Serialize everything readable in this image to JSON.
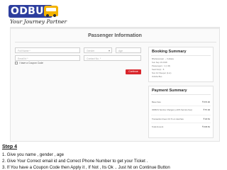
{
  "logo": {
    "brand": "ODBUS",
    "tagline": "Your Journey Partner"
  },
  "page": {
    "title": "Passenger Information"
  },
  "form": {
    "full_name_placeholder": "Full Name *",
    "gender_value": "Gender",
    "age_placeholder": "Age",
    "email_placeholder": "Email Id *",
    "phone_placeholder": "Contact No. *",
    "coupon_label": "I have a Coupon Code",
    "continue_label": "Continue"
  },
  "booking_summary": {
    "title": "Booking Summary",
    "lines": [
      "Bhubaneswar → Kolkata",
      "Sun Sep 16 2018",
      "Passengers : 1 (1 M)",
      "Seat No(s) : 8",
      "Non AC Sleeper (2+1)",
      "Odisha Bus"
    ]
  },
  "payment_summary": {
    "title": "Payment Summary",
    "rows": [
      {
        "label": "Base Fare",
        "value": "₹ 570.00"
      },
      {
        "label": "ODBUS Service Charges (+10% Service Fee)",
        "value": "₹ 57.00"
      },
      {
        "label": "Transaction Fees 3.0 % on total fare",
        "value": "₹ 18.81"
      },
      {
        "label": "Total Amount",
        "value": "₹ 645.81"
      }
    ]
  },
  "instructions": {
    "step": "Step 4",
    "lines": [
      "1. Give you name , gender , age",
      "2. Give Your Correct email id and Correct Phone Number to get your Ticket .",
      "3. If You have a Coupon Code then Apply it , If Not , Its Ok .. Just hit on Continue Button"
    ]
  },
  "colors": {
    "brand_blue": "#2d3e9e",
    "bus_yellow": "#f4b400",
    "continue_red": "#d9262c"
  }
}
